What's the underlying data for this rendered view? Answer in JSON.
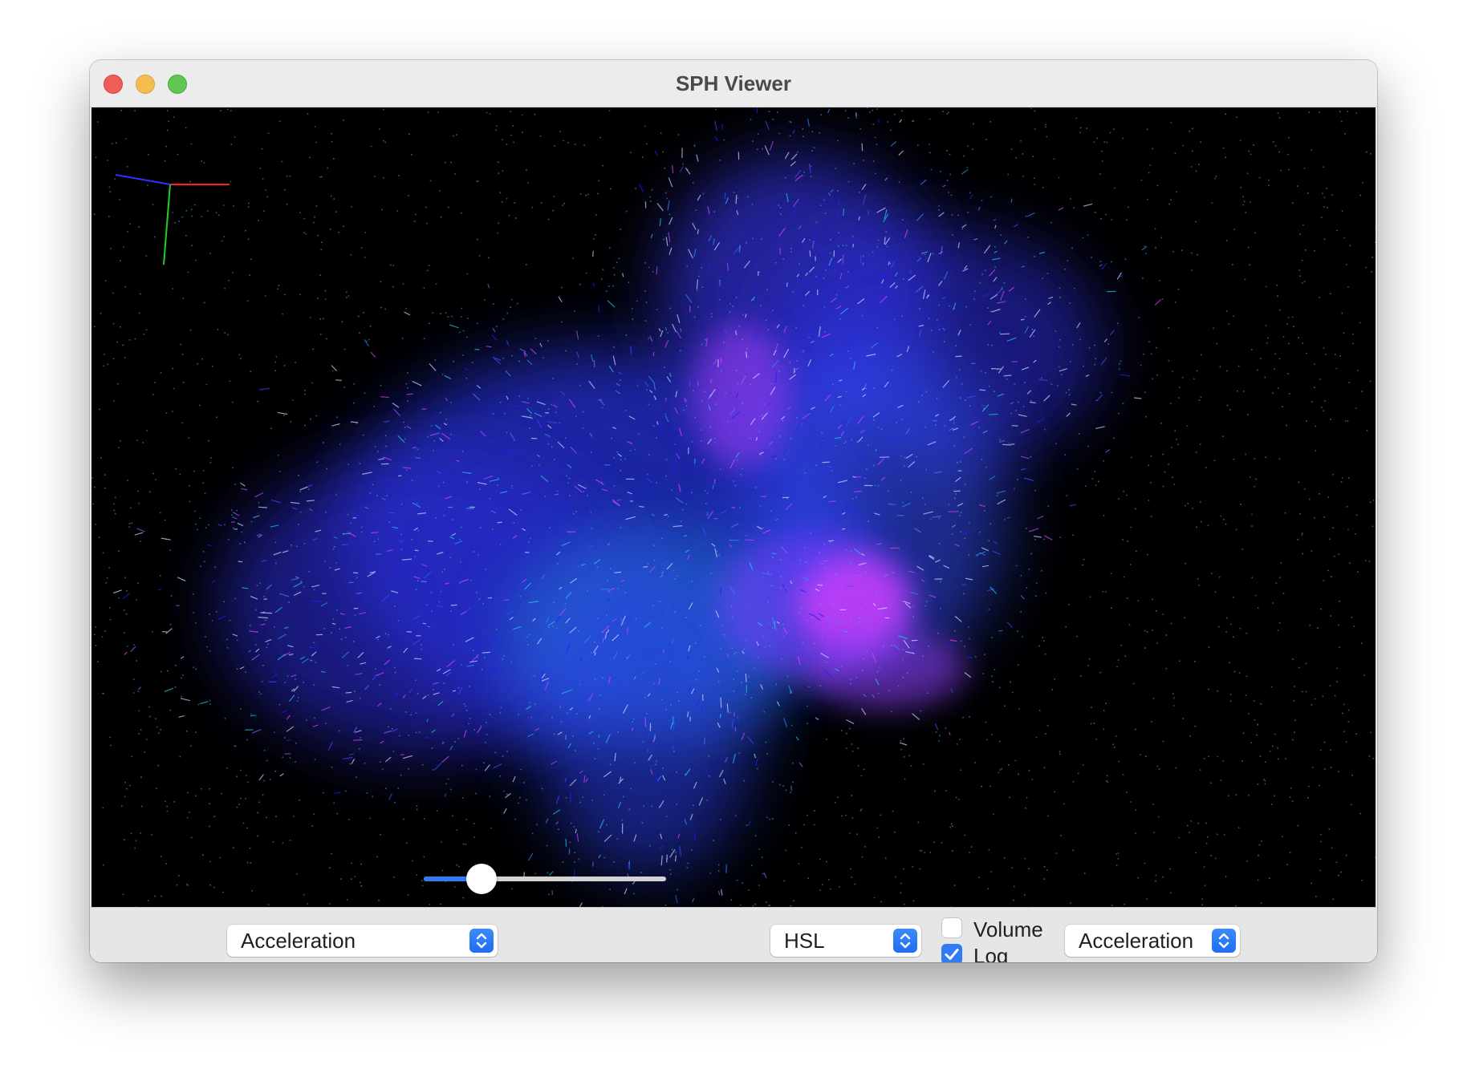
{
  "window": {
    "title": "SPH Viewer"
  },
  "controls": {
    "quantity_popup": {
      "selected": "Acceleration"
    },
    "slider": {
      "value_fraction": 0.24
    },
    "colormap_popup": {
      "selected": "HSL"
    },
    "volume_checkbox": {
      "label": "Volume",
      "checked": false
    },
    "log_checkbox": {
      "label": "Log",
      "checked": true
    },
    "vector_popup": {
      "selected": "Acceleration"
    }
  },
  "viewport": {
    "background": "#000000",
    "axes_colors": {
      "x": "#ff2020",
      "y": "#20d020",
      "z": "#3030ff"
    },
    "particle_palette": [
      "#2a1aff",
      "#3b4cff",
      "#2d8cff",
      "#27c8e6",
      "#b04cff",
      "#e040ff"
    ]
  },
  "icons": {
    "close": "close-traffic-light-icon",
    "minimize": "minimize-traffic-light-icon",
    "maximize": "maximize-traffic-light-icon",
    "stepper": "chevron-up-down-icon",
    "check": "checkmark-icon"
  }
}
